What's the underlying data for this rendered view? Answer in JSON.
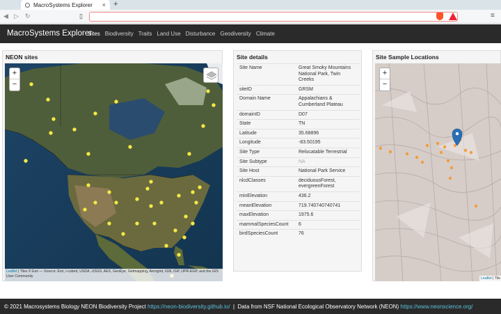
{
  "browser": {
    "tab_title": "MacroSystems Explorer",
    "new_tab": "+",
    "tab_close": "×"
  },
  "navbar": {
    "brand": "MacroSystems Explorer",
    "items": [
      "Sites",
      "Biodiversity",
      "Traits",
      "Land Use",
      "Disturbance",
      "Geodiversity",
      "Climate"
    ],
    "active": "Sites"
  },
  "neon_panel": {
    "title": "NEON sites",
    "zoom_in": "+",
    "zoom_out": "−",
    "attribution_link": "Leaflet",
    "attribution": " | Tiles © Esri — Source: Esri, i-cubed, USDA, USGS, AEX, GeoEye, Getmapping, Aerogrid, IGN, IGP, UPR-EGP, and the GIS User Community"
  },
  "details_panel": {
    "title": "Site details",
    "rows": [
      {
        "key": "Site Name",
        "value": "Great Smoky Mountains National Park, Twin Creeks"
      },
      {
        "key": "siteID",
        "value": "GRSM"
      },
      {
        "key": "Domain Name",
        "value": "Appalachians & Cumberland Plateau"
      },
      {
        "key": "domainID",
        "value": "D07"
      },
      {
        "key": "State",
        "value": "TN"
      },
      {
        "key": "Latitude",
        "value": "35.68896"
      },
      {
        "key": "Longitude",
        "value": "-83.50195"
      },
      {
        "key": "Site Type",
        "value": "Relocatable Terrestrial"
      },
      {
        "key": "Site Subtype",
        "value": "NA"
      },
      {
        "key": "Site Host",
        "value": "National Park Service"
      },
      {
        "key": "nlcdClasses",
        "value": "deciduousForest, evergreenForest"
      },
      {
        "key": "minElevation",
        "value": "436.2"
      },
      {
        "key": "meanElevation",
        "value": "719.740740740741"
      },
      {
        "key": "maxElevation",
        "value": "1975.6"
      },
      {
        "key": "mammalSpeciesCount",
        "value": "6"
      },
      {
        "key": "birdSpeciesCount",
        "value": "76"
      }
    ]
  },
  "samples_panel": {
    "title": "Site Sample Locations",
    "zoom_in": "+",
    "zoom_out": "−",
    "attribution_link": "Leaflet",
    "attribution": " | Tile"
  },
  "footer": {
    "copyright": "© 2021 Macrosystems Biology NEON Biodiversity Project ",
    "project_link": "https://neon-biodiversity.github.io/",
    "separator": "  |  ",
    "data_text": "Data from NSF National Ecological Observatory Network (NEON) ",
    "neon_link": "https://www.neonscience.org/"
  },
  "colors": {
    "site_marker": "#f2e94e",
    "sample_marker": "#f39c3c",
    "selected_marker": "#2a6fb5",
    "link": "#5bc0de"
  }
}
